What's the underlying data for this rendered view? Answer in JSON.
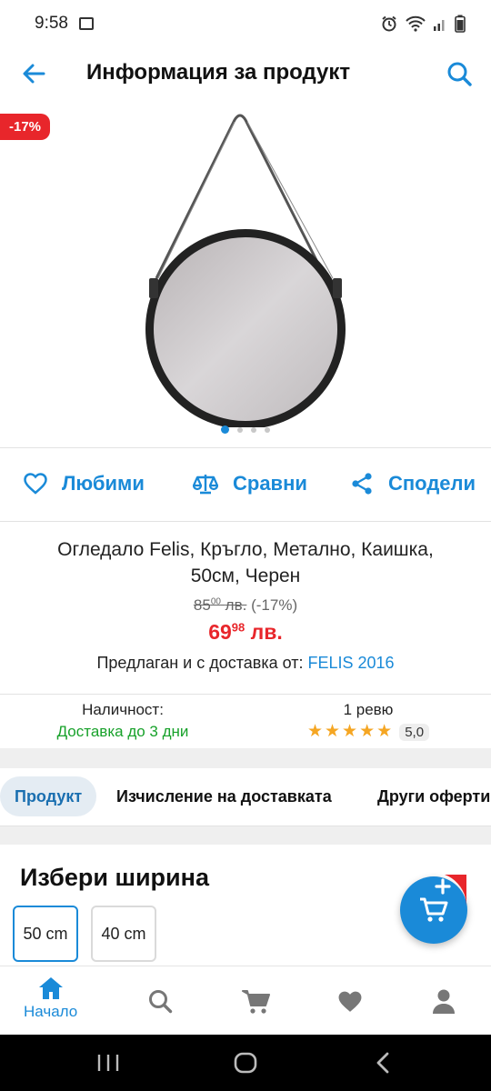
{
  "status_bar": {
    "time": "9:58"
  },
  "header": {
    "title": "Информация за продукт"
  },
  "gallery": {
    "discount_badge": "-17%",
    "slide_count": 4,
    "active_slide": 1
  },
  "actions": {
    "favorite": "Любими",
    "compare": "Сравни",
    "share": "Сподели"
  },
  "product": {
    "name": "Огледало Felis, Кръгло, Метално, Каишка, 50см, Черен",
    "old_price_int": "85",
    "old_price_dec": "00",
    "old_price_currency": "лв.",
    "old_price_discount": "(-17%)",
    "price_int": "69",
    "price_dec": "98",
    "price_currency": "лв.",
    "seller_prefix": "Предлаган и с доставка от:",
    "seller_name": "FELIS 2016"
  },
  "availability": {
    "label": "Наличност:",
    "value": "Доставка до 3 дни"
  },
  "reviews": {
    "count_label": "1 ревю",
    "stars": 5,
    "rating": "5,0"
  },
  "tabs": [
    {
      "label": "Продукт",
      "active": true
    },
    {
      "label": "Изчисление на доставката",
      "active": false
    },
    {
      "label": "Други оферти",
      "active": false
    }
  ],
  "width_selector": {
    "title": "Избери ширина",
    "options": [
      {
        "label": "50 cm",
        "selected": true
      },
      {
        "label": "40 cm",
        "selected": false
      }
    ]
  },
  "bottom_nav": [
    {
      "label": "Начало",
      "icon": "home-icon",
      "active": true
    },
    {
      "label": "",
      "icon": "search-icon",
      "active": false
    },
    {
      "label": "",
      "icon": "cart-icon",
      "active": false
    },
    {
      "label": "",
      "icon": "heart-icon",
      "active": false
    },
    {
      "label": "",
      "icon": "user-icon",
      "active": false
    }
  ],
  "colors": {
    "accent": "#1a8ad8",
    "sale": "#e8262b",
    "success": "#17a12a",
    "star": "#f5a623"
  }
}
